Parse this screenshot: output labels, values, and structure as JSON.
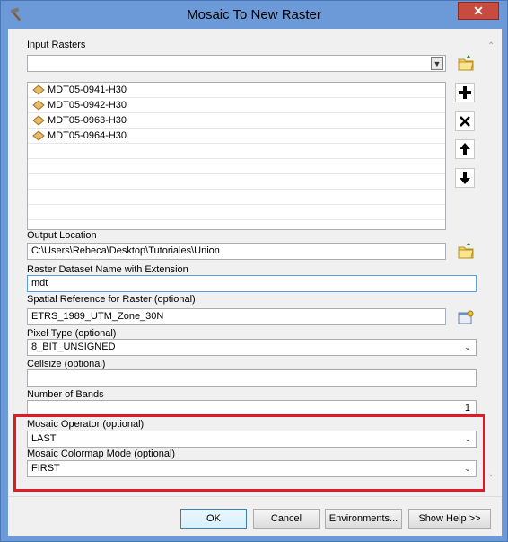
{
  "window": {
    "title": "Mosaic To New Raster",
    "close_label": "✕"
  },
  "input_rasters": {
    "label": "Input Rasters",
    "value": "",
    "items": [
      {
        "label": "MDT05-0941-H30"
      },
      {
        "label": "MDT05-0942-H30"
      },
      {
        "label": "MDT05-0963-H30"
      },
      {
        "label": "MDT05-0964-H30"
      }
    ]
  },
  "output_location": {
    "label": "Output Location",
    "value": "C:\\Users\\Rebeca\\Desktop\\Tutoriales\\Union"
  },
  "raster_name": {
    "label": "Raster Dataset Name with Extension",
    "value": "mdt"
  },
  "spatial_reference": {
    "label": "Spatial Reference for Raster (optional)",
    "value": "ETRS_1989_UTM_Zone_30N"
  },
  "pixel_type": {
    "label": "Pixel Type (optional)",
    "value": "8_BIT_UNSIGNED"
  },
  "cellsize": {
    "label": "Cellsize (optional)",
    "value": ""
  },
  "number_of_bands": {
    "label": "Number of Bands",
    "value": "1"
  },
  "mosaic_operator": {
    "label": "Mosaic Operator (optional)",
    "value": "LAST"
  },
  "colormap_mode": {
    "label": "Mosaic Colormap Mode (optional)",
    "value": "FIRST"
  },
  "footer": {
    "ok_label": "OK",
    "cancel_label": "Cancel",
    "environments_label": "Environments...",
    "show_help_label": "Show Help >>"
  },
  "colors": {
    "titlebar": "#6c99d8",
    "highlight_border": "#e01b24",
    "close_button": "#c74b3f"
  }
}
